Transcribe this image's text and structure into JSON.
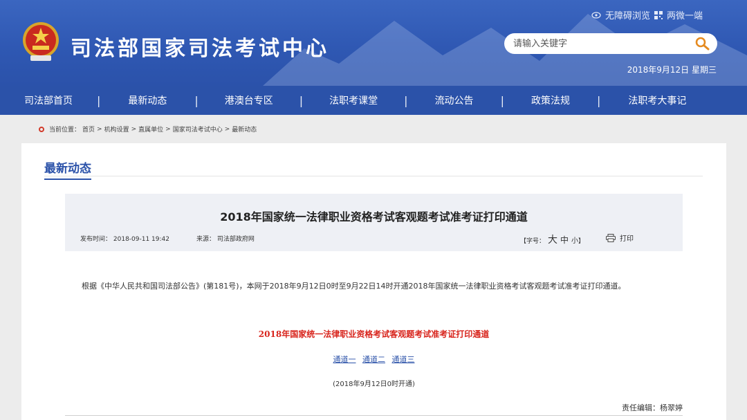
{
  "header": {
    "site_title": "司法部国家司法考试中心",
    "accessibility_link": "无障碍浏览",
    "mobile_link": "两微一端",
    "search_placeholder": "请输入关键字",
    "date": "2018年9月12日 星期三"
  },
  "nav": {
    "items": [
      "司法部首页",
      "最新动态",
      "港澳台专区",
      "法职考课堂",
      "流动公告",
      "政策法规",
      "法职考大事记"
    ]
  },
  "breadcrumb": {
    "label": "当前位置：",
    "items": [
      "首页",
      "机构设置",
      "直属单位",
      "国家司法考试中心",
      "最新动态"
    ],
    "separator": ">"
  },
  "section": {
    "title": "最新动态"
  },
  "article": {
    "title": "2018年国家统一法律职业资格考试客观题考试准考证打印通道",
    "date_label": "发布时间：",
    "date_value": "2018-09-11 19:42",
    "source_label": "来源：",
    "source_value": "司法部政府网",
    "font_size_label": "【字号：",
    "font_large": "大",
    "font_medium": "中",
    "font_small": "小",
    "font_size_close": "】",
    "print_label": "打印",
    "body": "根据《中华人民共和国司法部公告》(第181号)，本网于2018年9月12日0时至9月22日14时开通2018年国家统一法律职业资格考试客观题考试准考证打印通道。",
    "red_title": "2018年国家统一法律职业资格考试客观题考试准考证打印通道",
    "channels": [
      "通道一",
      "通道二",
      "通道三"
    ],
    "open_note": "(2018年9月12日0时开通)",
    "editor": "责任编辑：杨翠婷"
  },
  "colors": {
    "primary_blue": "#2b52a9",
    "header_blue": "#3560ba",
    "accent_red": "#d8241c"
  }
}
